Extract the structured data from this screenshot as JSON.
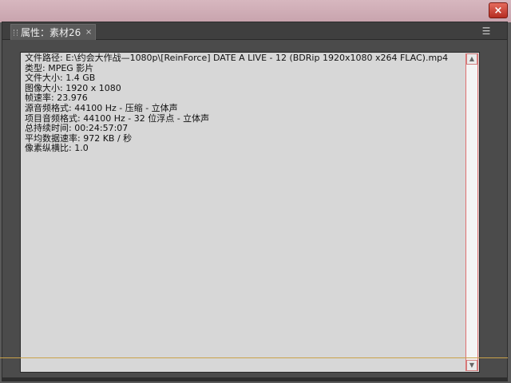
{
  "window": {
    "close_glyph": "×"
  },
  "panel": {
    "tab_label": "属性：素材26",
    "tab_close": "×",
    "menu_icon": "menu-icon"
  },
  "info_lines": [
    "文件路径: E:\\约会大作战—1080p\\[ReinForce] DATE A LIVE - 12 (BDRip 1920x1080 x264 FLAC).mp4",
    "类型: MPEG 影片",
    "文件大小: 1.4 GB",
    "图像大小: 1920 x 1080",
    "帧速率: 23.976",
    "源音频格式: 44100 Hz - 压缩 - 立体声",
    "项目音频格式: 44100 Hz - 32 位浮点 - 立体声",
    "总持续时间: 00:24:57:07",
    "平均数据速率: 972 KB / 秒",
    "像素纵横比: 1.0"
  ],
  "scrollbar": {
    "up_glyph": "▲",
    "down_glyph": "▼"
  }
}
